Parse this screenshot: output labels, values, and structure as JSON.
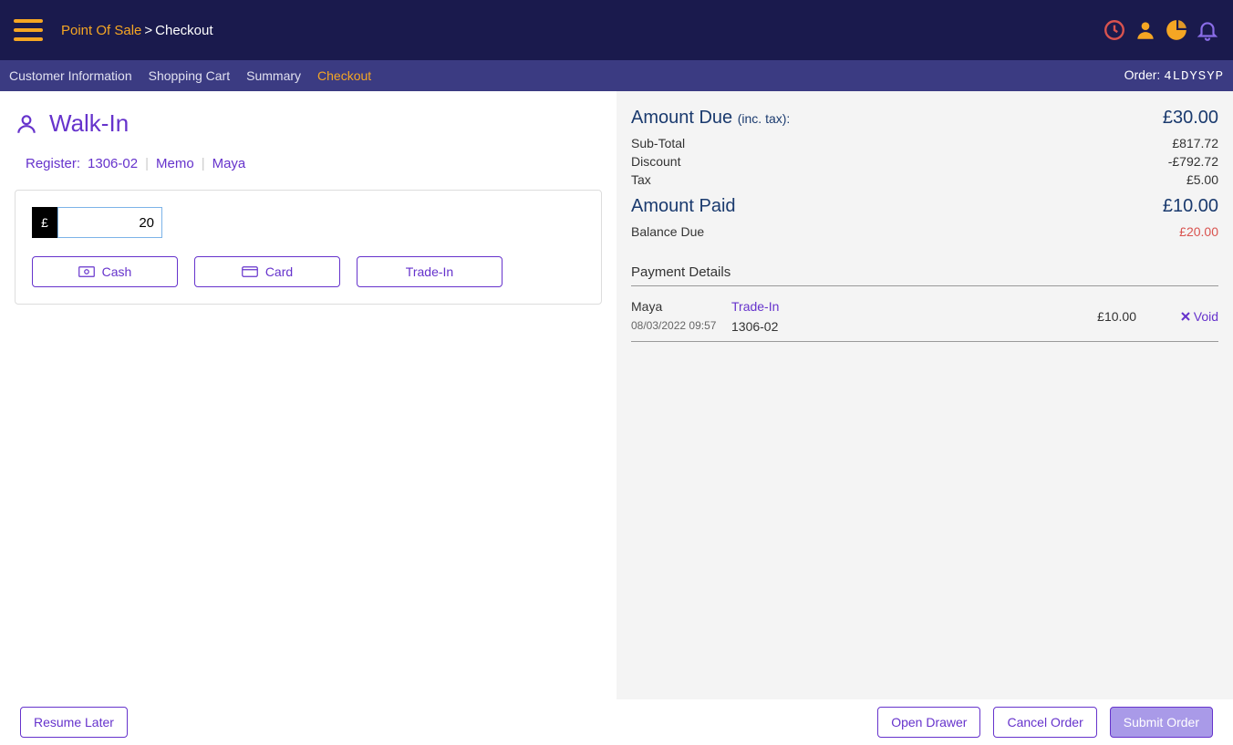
{
  "header": {
    "breadcrumb_root": "Point Of Sale",
    "breadcrumb_sep": ">",
    "breadcrumb_page": "Checkout"
  },
  "subheader": {
    "tabs": [
      {
        "label": "Customer Information"
      },
      {
        "label": "Shopping Cart"
      },
      {
        "label": "Summary"
      },
      {
        "label": "Checkout"
      }
    ],
    "order_label": "Order:",
    "order_id": "4LDYSYP"
  },
  "left": {
    "customer_name": "Walk-In",
    "register_label": "Register:",
    "register_value": "1306-02",
    "memo_label": "Memo",
    "user_name": "Maya",
    "currency_symbol": "£",
    "amount_value": "20",
    "buttons": {
      "cash": "Cash",
      "card": "Card",
      "tradein": "Trade-In"
    }
  },
  "right": {
    "amount_due_label": "Amount Due",
    "inc_tax": "(inc. tax):",
    "amount_due_value": "£30.00",
    "subtotal_label": "Sub-Total",
    "subtotal_value": "£817.72",
    "discount_label": "Discount",
    "discount_value": "-£792.72",
    "tax_label": "Tax",
    "tax_value": "£5.00",
    "amount_paid_label": "Amount Paid",
    "amount_paid_value": "£10.00",
    "balance_due_label": "Balance Due",
    "balance_due_value": "£20.00",
    "payment_details_title": "Payment Details",
    "payments": [
      {
        "name": "Maya",
        "datetime": "08/03/2022 09:57",
        "type": "Trade-In",
        "register": "1306-02",
        "amount": "£10.00",
        "void_label": "Void"
      }
    ]
  },
  "footer": {
    "resume": "Resume Later",
    "open_drawer": "Open Drawer",
    "cancel": "Cancel Order",
    "submit": "Submit Order"
  }
}
